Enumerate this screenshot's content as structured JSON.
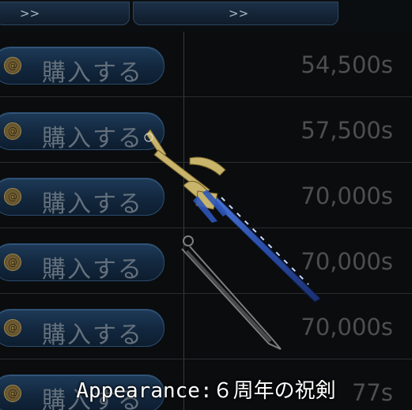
{
  "tabs": [
    {
      "label": ">>"
    },
    {
      "label": ">>"
    }
  ],
  "shop_rows": [
    {
      "button_label": "購入する",
      "price": "54,500s"
    },
    {
      "button_label": "購入する",
      "price": "57,500s"
    },
    {
      "button_label": "購入する",
      "price": "70,000s"
    },
    {
      "button_label": "購入する",
      "price": "70,000s"
    },
    {
      "button_label": "購入する",
      "price": "70,000s"
    },
    {
      "button_label": "購入する",
      "price": "77s"
    }
  ],
  "caption": "Appearance:６周年の祝剣",
  "colors": {
    "button": "#1e3a58",
    "price_text": "#4e4e4e",
    "caption": "#ffffff"
  },
  "item_icon": "sword-icon"
}
